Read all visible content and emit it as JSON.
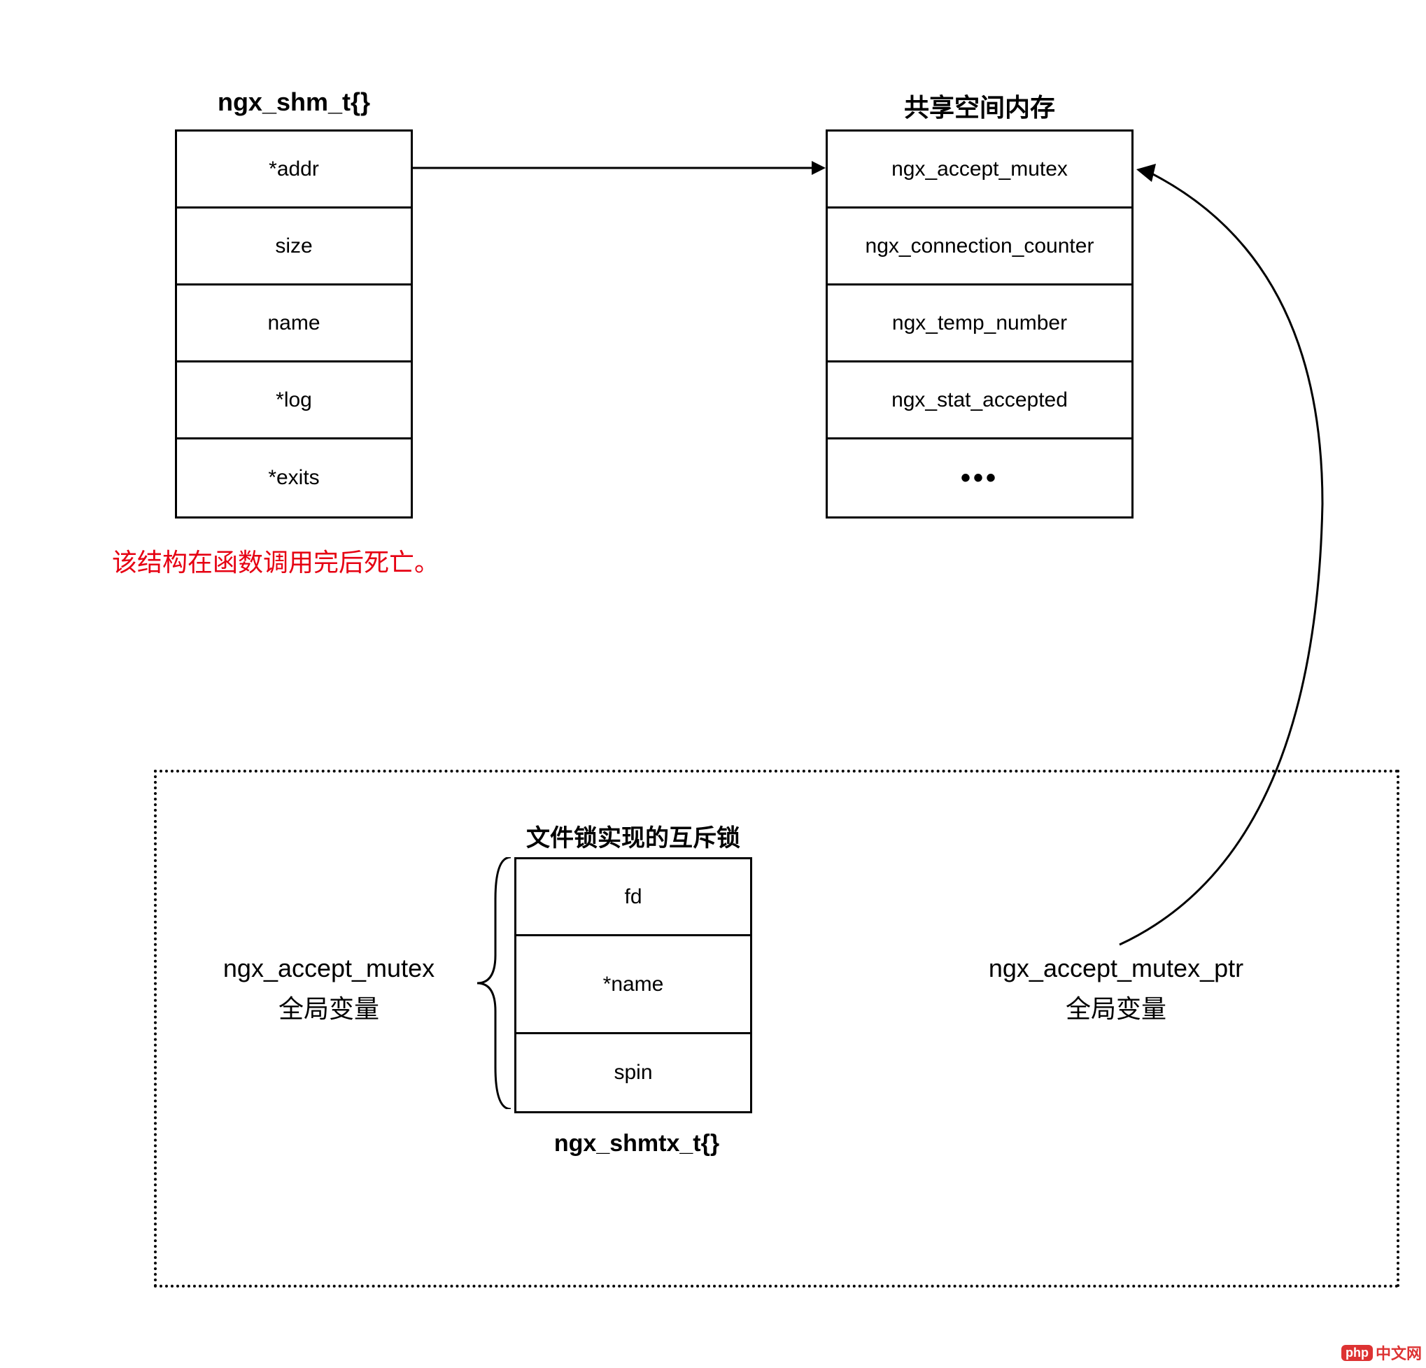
{
  "shm_struct": {
    "title": "ngx_shm_t{}",
    "cells": [
      "*addr",
      "size",
      "name",
      "*log",
      "*exits"
    ]
  },
  "shared_mem": {
    "title": "共享空间内存",
    "cells": [
      "ngx_accept_mutex",
      "ngx_connection_counter",
      "ngx_temp_number",
      "ngx_stat_accepted",
      "•••"
    ]
  },
  "note": "该结构在函数调用完后死亡。",
  "mutex_struct": {
    "title": "文件锁实现的互斥锁",
    "cells": [
      "fd",
      "*name",
      "spin"
    ],
    "footer": "ngx_shmtx_t{}"
  },
  "left_label": {
    "line1": "ngx_accept_mutex",
    "line2": "全局变量"
  },
  "right_label": {
    "line1": "ngx_accept_mutex_ptr",
    "line2": "全局变量"
  },
  "watermark": {
    "logo": "php",
    "text": "中文网"
  }
}
